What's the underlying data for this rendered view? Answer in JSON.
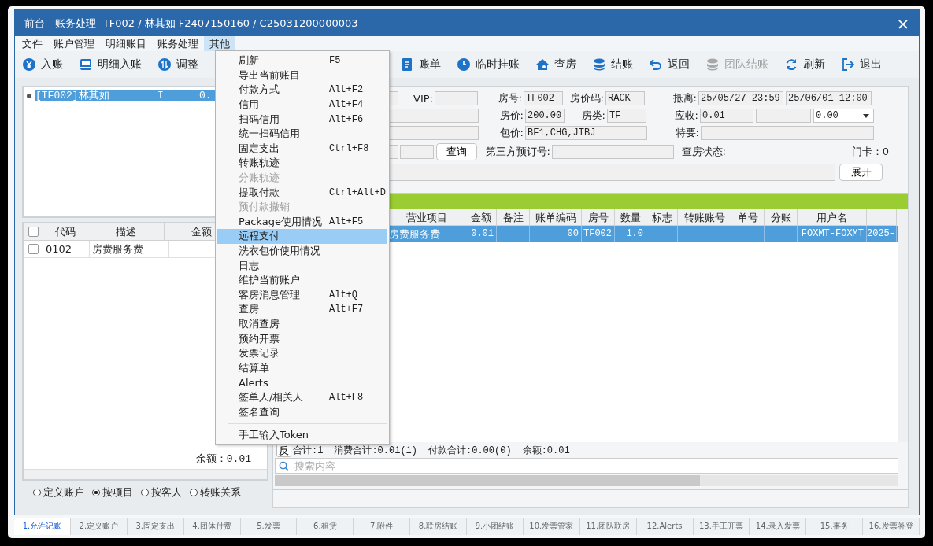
{
  "window": {
    "title": "前台 - 账务处理 -TF002 / 林其如 F2407150160 / C25031200000003",
    "close": "×"
  },
  "menu_bar": [
    {
      "label": "文件",
      "selected": false
    },
    {
      "label": "账户管理",
      "selected": false
    },
    {
      "label": "明细账目",
      "selected": false
    },
    {
      "label": "账务处理",
      "selected": false
    },
    {
      "label": "其他",
      "selected": true
    }
  ],
  "toolbar": [
    {
      "label": "入账",
      "kind": "yen",
      "disabled": false
    },
    {
      "label": "明细入账",
      "kind": "ledger",
      "disabled": false
    },
    {
      "label": "调整",
      "kind": "adjust",
      "disabled": false
    },
    {
      "label": "账单",
      "kind": "bill",
      "disabled": false
    },
    {
      "label": "临时挂账",
      "kind": "clock",
      "disabled": false
    },
    {
      "label": "查房",
      "kind": "house",
      "disabled": false
    },
    {
      "label": "结账",
      "kind": "coins",
      "disabled": false
    },
    {
      "label": "返回",
      "kind": "back",
      "disabled": false
    },
    {
      "label": "团队结账",
      "kind": "coins",
      "disabled": true
    },
    {
      "label": "刷新",
      "kind": "refresh",
      "disabled": false
    },
    {
      "label": "退出",
      "kind": "exit",
      "disabled": false
    }
  ],
  "dropdown_menu": [
    {
      "kind": "item",
      "label": "刷新",
      "shortcut": "F5",
      "disabled": false,
      "selected": false
    },
    {
      "kind": "item",
      "label": "导出当前账目",
      "disabled": false,
      "selected": false
    },
    {
      "kind": "item",
      "label": "付款方式",
      "shortcut": "Alt+F2",
      "disabled": false,
      "selected": false
    },
    {
      "kind": "item",
      "label": "信用",
      "shortcut": "Alt+F4",
      "disabled": false,
      "selected": false
    },
    {
      "kind": "item",
      "label": "扫码信用",
      "shortcut": "Alt+F6",
      "disabled": false,
      "selected": false
    },
    {
      "kind": "item",
      "label": "统一扫码信用",
      "disabled": false,
      "selected": false
    },
    {
      "kind": "item",
      "label": "固定支出",
      "shortcut": "Ctrl+F8",
      "disabled": false,
      "selected": false
    },
    {
      "kind": "item",
      "label": "转账轨迹",
      "disabled": false,
      "selected": false
    },
    {
      "kind": "item",
      "label": "分账轨迹",
      "disabled": true,
      "selected": false
    },
    {
      "kind": "item",
      "label": "提取付款",
      "shortcut": "Ctrl+Alt+D",
      "disabled": false,
      "selected": false
    },
    {
      "kind": "item",
      "label": "预付款撤销",
      "disabled": true,
      "selected": false
    },
    {
      "kind": "item",
      "label": "Package使用情况",
      "shortcut": "Alt+F5",
      "disabled": false,
      "selected": false
    },
    {
      "kind": "item",
      "label": "远程支付",
      "disabled": false,
      "selected": true
    },
    {
      "kind": "item",
      "label": "洗衣包价使用情况",
      "disabled": false,
      "selected": false
    },
    {
      "kind": "item",
      "label": "日志",
      "disabled": false,
      "selected": false
    },
    {
      "kind": "item",
      "label": "维护当前账户",
      "disabled": false,
      "selected": false
    },
    {
      "kind": "item",
      "label": "客房消息管理",
      "shortcut": "Alt+Q",
      "disabled": false,
      "selected": false
    },
    {
      "kind": "item",
      "label": "查房",
      "shortcut": "Alt+F7",
      "disabled": false,
      "selected": false
    },
    {
      "kind": "item",
      "label": "取消查房",
      "disabled": false,
      "selected": false
    },
    {
      "kind": "item",
      "label": "预约开票",
      "disabled": false,
      "selected": false
    },
    {
      "kind": "item",
      "label": "发票记录",
      "disabled": false,
      "selected": false
    },
    {
      "kind": "item",
      "label": "结算单",
      "disabled": false,
      "selected": false
    },
    {
      "kind": "item",
      "label": "Alerts",
      "disabled": false,
      "selected": false
    },
    {
      "kind": "item",
      "label": "签单人/相关人",
      "shortcut": "Alt+F8",
      "disabled": false,
      "selected": false
    },
    {
      "kind": "item",
      "label": "签名查询",
      "disabled": false,
      "selected": false
    },
    {
      "kind": "separator"
    },
    {
      "kind": "item",
      "label": "手工输入Token",
      "disabled": false,
      "selected": false
    }
  ],
  "guest_list": [
    {
      "label": "[TF002]林其如",
      "status": "I",
      "amount": "0.",
      "selected": true
    }
  ],
  "item_table": {
    "header_checked": false,
    "columns": [
      "代码",
      "描述",
      "金额"
    ],
    "rows": [
      {
        "checked": false,
        "code": "0102",
        "description": "房费服务费"
      }
    ]
  },
  "balance": "余额：0.01",
  "view_options": [
    {
      "label": "定义账户",
      "selected": false
    },
    {
      "label": "按项目",
      "selected": true
    },
    {
      "label": "按客人",
      "selected": false
    },
    {
      "label": "转账关系",
      "selected": false
    }
  ],
  "form": {
    "vip": {
      "label": "VIP:"
    },
    "room_no": {
      "label": "房号:",
      "value": "TF002"
    },
    "rate_code": {
      "label": "房价码:",
      "value": "RACK"
    },
    "arrival_departure": {
      "label": "抵离:",
      "arrival": "25/05/27 23:59",
      "departure": "25/06/01 12:00"
    },
    "rate": {
      "label": "房价:",
      "value": "200.00"
    },
    "room_type": {
      "label": "房类:",
      "value": "TF"
    },
    "receivable": {
      "label": "应收:",
      "value": "0.01",
      "select": "0.00"
    },
    "package": {
      "label": "包价:",
      "value": "BF1,CHG,JTBJ"
    },
    "special": {
      "label": "特要:"
    },
    "query_button": "查询",
    "third_party_no": {
      "label": "第三方预订号:"
    },
    "check_status": {
      "label": "查房状态:"
    },
    "door_card": "门卡：0",
    "expand_button": "展开"
  },
  "ledger": {
    "columns": [
      "营业项目",
      "金额",
      "备注",
      "账单编码",
      "房号",
      "数量",
      "标志",
      "转账账号",
      "单号",
      "分账",
      "用户名"
    ],
    "rows": [
      {
        "selected": true,
        "cells": [
          "房费服务费",
          "0.01",
          null,
          "00",
          "TF002",
          "1.0",
          null,
          null,
          null,
          null,
          "FOXMT-FOXMT",
          "2025-"
        ]
      }
    ]
  },
  "summary": {
    "reverse_button": "反",
    "parts": [
      "合计:1",
      "消费合计:0.01(1)",
      "付款合计:0.00(0)",
      "余额:0.01"
    ]
  },
  "search": {
    "placeholder": "搜索内容"
  },
  "bottom_tabs": [
    {
      "label": "1.允许记账",
      "selected": true
    },
    {
      "label": "2.定义账户",
      "selected": false
    },
    {
      "label": "3.固定支出",
      "selected": false
    },
    {
      "label": "4.团体付费",
      "selected": false
    },
    {
      "label": "5.发票",
      "selected": false
    },
    {
      "label": "6.租赁",
      "selected": false
    },
    {
      "label": "7.附件",
      "selected": false
    },
    {
      "label": "8.联房结账",
      "selected": false
    },
    {
      "label": "9.小团结账",
      "selected": false
    },
    {
      "label": "10.发票管家",
      "selected": false
    },
    {
      "label": "11.团队联房",
      "selected": false
    },
    {
      "label": "12.Alerts",
      "selected": false
    },
    {
      "label": "13.手工开票",
      "selected": false
    },
    {
      "label": "14.录入发票",
      "selected": false
    },
    {
      "label": "15.事务",
      "selected": false
    },
    {
      "label": "16.发票补登",
      "selected": false
    }
  ]
}
